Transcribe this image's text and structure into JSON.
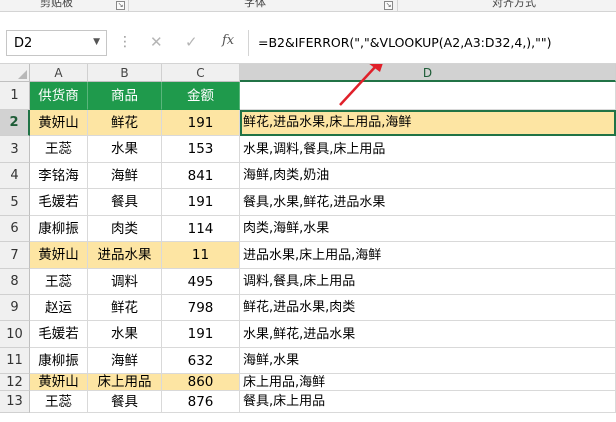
{
  "ribbon": {
    "groups": [
      {
        "label": "剪贴板"
      },
      {
        "label": "字体"
      },
      {
        "label": "对齐方式"
      }
    ]
  },
  "formula_bar": {
    "name_box": "D2",
    "cancel_icon": "✕",
    "enter_icon": "✓",
    "fx_label": "fx",
    "formula": "=B2&IFERROR(\",\"&VLOOKUP(A2,A3:D32,4,),\"\")"
  },
  "sheet": {
    "columns": [
      "A",
      "B",
      "C",
      "D"
    ],
    "header_row": {
      "row": "1",
      "a": "供货商",
      "b": "商品",
      "c": "金额",
      "d": ""
    },
    "rows": [
      {
        "row": "2",
        "a": "黄妍山",
        "b": "鲜花",
        "c": "191",
        "d": "鲜花,进品水果,床上用品,海鲜"
      },
      {
        "row": "3",
        "a": "王蕊",
        "b": "水果",
        "c": "153",
        "d": "水果,调料,餐具,床上用品"
      },
      {
        "row": "4",
        "a": "李铭海",
        "b": "海鲜",
        "c": "841",
        "d": "海鲜,肉类,奶油"
      },
      {
        "row": "5",
        "a": "毛媛若",
        "b": "餐具",
        "c": "191",
        "d": "餐具,水果,鲜花,进品水果"
      },
      {
        "row": "6",
        "a": "康柳振",
        "b": "肉类",
        "c": "114",
        "d": "肉类,海鲜,水果"
      },
      {
        "row": "7",
        "a": "黄妍山",
        "b": "进品水果",
        "c": "11",
        "d": "进品水果,床上用品,海鲜"
      },
      {
        "row": "8",
        "a": "王蕊",
        "b": "调料",
        "c": "495",
        "d": "调料,餐具,床上用品"
      },
      {
        "row": "9",
        "a": "赵运",
        "b": "鲜花",
        "c": "798",
        "d": "鲜花,进品水果,肉类"
      },
      {
        "row": "10",
        "a": "毛媛若",
        "b": "水果",
        "c": "191",
        "d": "水果,鲜花,进品水果"
      },
      {
        "row": "11",
        "a": "康柳振",
        "b": "海鲜",
        "c": "632",
        "d": "海鲜,水果"
      },
      {
        "row": "12",
        "a": "黄妍山",
        "b": "床上用品",
        "c": "860",
        "d": "床上用品,海鲜"
      },
      {
        "row": "13",
        "a": "王蕊",
        "b": "餐具",
        "c": "876",
        "d": "餐具,床上用品"
      }
    ],
    "highlighted_rows": [
      "2",
      "7",
      "12"
    ],
    "active_cell": "D2"
  },
  "colors": {
    "header_fill": "#1f9a4c",
    "highlight_fill": "#fde5a3",
    "arrow": "#e0202a",
    "selection": "#217346"
  },
  "icons": {
    "arrow": "red-annotation-arrow-icon",
    "launcher": "dialog-launcher-icon",
    "corner": "select-all-icon"
  }
}
